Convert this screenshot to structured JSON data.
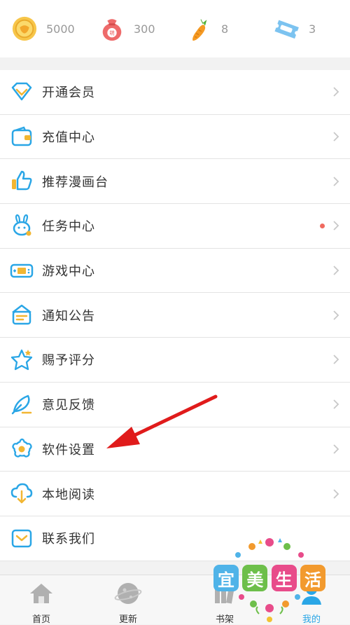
{
  "stats": [
    {
      "icon": "coin-icon",
      "value": "5000"
    },
    {
      "icon": "money-bag-icon",
      "value": "300",
      "badge": "萌"
    },
    {
      "icon": "carrot-icon",
      "value": "8"
    },
    {
      "icon": "ticket-icon",
      "value": "3"
    }
  ],
  "menu": {
    "items": [
      {
        "label": "开通会员",
        "icon": "diamond-icon"
      },
      {
        "label": "充值中心",
        "icon": "wallet-icon"
      },
      {
        "label": "推荐漫画台",
        "icon": "thumbs-up-icon"
      },
      {
        "label": "任务中心",
        "icon": "rabbit-icon",
        "has_dot": true
      },
      {
        "label": "游戏中心",
        "icon": "gamepad-icon"
      },
      {
        "label": "通知公告",
        "icon": "notice-icon"
      },
      {
        "label": "赐予评分",
        "icon": "star-icon"
      },
      {
        "label": "意见反馈",
        "icon": "feather-icon"
      },
      {
        "label": "软件设置",
        "icon": "gear-icon"
      },
      {
        "label": "本地阅读",
        "icon": "cloud-download-icon"
      },
      {
        "label": "联系我们",
        "icon": "mail-icon"
      }
    ]
  },
  "tabbar": {
    "tabs": [
      {
        "label": "首页",
        "icon": "home-icon"
      },
      {
        "label": "更新",
        "icon": "planet-icon"
      },
      {
        "label": "书架",
        "icon": "bookshelf-icon"
      },
      {
        "label": "我的",
        "icon": "profile-icon",
        "active": true
      }
    ]
  },
  "watermark": {
    "chars": [
      "宜",
      "美",
      "生",
      "活"
    ],
    "colors": [
      "#4fb3e8",
      "#6dbf4a",
      "#e84c8a",
      "#f29a2e"
    ]
  },
  "colors": {
    "accent": "#2aa6e6",
    "arrow": "#e01b1b",
    "dot": "#f06a5f"
  }
}
